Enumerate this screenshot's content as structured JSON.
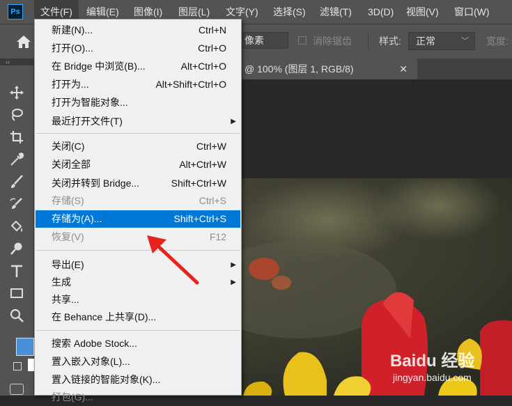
{
  "menubar": {
    "logo": "Ps",
    "items": [
      "文件(F)",
      "编辑(E)",
      "图像(I)",
      "图层(L)",
      "文字(Y)",
      "选择(S)",
      "滤镜(T)",
      "3D(D)",
      "视图(V)",
      "窗口(W)"
    ]
  },
  "options": {
    "feather_value": "像素",
    "antialias_label": "消除锯齿",
    "style_label": "样式:",
    "style_value": "正常",
    "width_label": "宽度:"
  },
  "toolbar": {
    "collapse": "‹‹"
  },
  "document_tab": {
    "title": "@ 100% (图层 1, RGB/8)",
    "close": "✕"
  },
  "file_menu": {
    "items": [
      {
        "label": "新建(N)...",
        "shortcut": "Ctrl+N"
      },
      {
        "label": "打开(O)...",
        "shortcut": "Ctrl+O"
      },
      {
        "label": "在 Bridge 中浏览(B)...",
        "shortcut": "Alt+Ctrl+O"
      },
      {
        "label": "打开为...",
        "shortcut": "Alt+Shift+Ctrl+O"
      },
      {
        "label": "打开为智能对象...",
        "shortcut": ""
      },
      {
        "label": "最近打开文件(T)",
        "shortcut": ""
      },
      {
        "label": "关闭(C)",
        "shortcut": "Ctrl+W"
      },
      {
        "label": "关闭全部",
        "shortcut": "Alt+Ctrl+W"
      },
      {
        "label": "关闭并转到 Bridge...",
        "shortcut": "Shift+Ctrl+W"
      },
      {
        "label": "存储(S)",
        "shortcut": "Ctrl+S"
      },
      {
        "label": "存储为(A)...",
        "shortcut": "Shift+Ctrl+S"
      },
      {
        "label": "恢复(V)",
        "shortcut": "F12"
      },
      {
        "label": "导出(E)",
        "shortcut": ""
      },
      {
        "label": "生成",
        "shortcut": ""
      },
      {
        "label": "共享...",
        "shortcut": ""
      },
      {
        "label": "在 Behance 上共享(D)...",
        "shortcut": ""
      },
      {
        "label": "搜索 Adobe Stock...",
        "shortcut": ""
      },
      {
        "label": "置入嵌入对象(L)...",
        "shortcut": ""
      },
      {
        "label": "置入链接的智能对象(K)...",
        "shortcut": ""
      },
      {
        "label": "打包(G)...",
        "shortcut": ""
      }
    ]
  },
  "watermark": {
    "logo": "Baidu 经验",
    "url": "jingyan.baidu.com"
  },
  "colors": {
    "highlight": "#0078d7",
    "foreground": "#4a90d9",
    "arrow": "#e8231f"
  }
}
